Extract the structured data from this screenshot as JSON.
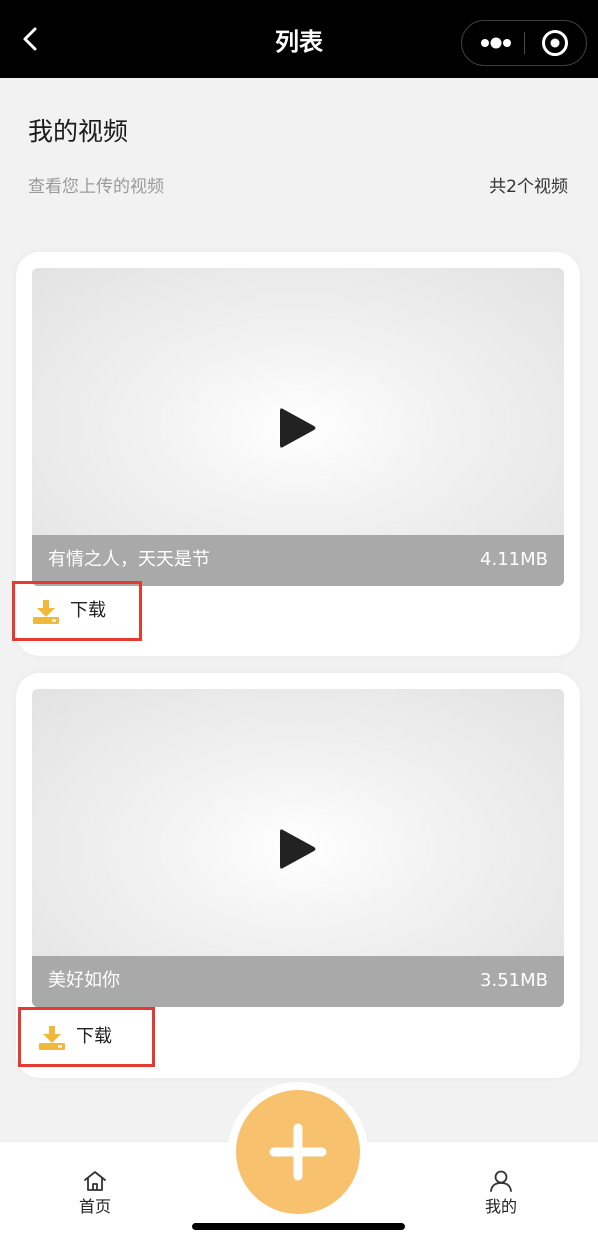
{
  "nav": {
    "title": "列表",
    "back_icon": "chevron-left-icon",
    "more_icon": "more-dots-icon",
    "close_icon": "target-circle-icon"
  },
  "header": {
    "title": "我的视频",
    "subtitle": "查看您上传的视频",
    "count": "共2个视频"
  },
  "videos": [
    {
      "title": "有情之人，天天是节",
      "size": "4.11MB",
      "download_label": "下载"
    },
    {
      "title": "美好如你",
      "size": "3.51MB",
      "download_label": "下载"
    }
  ],
  "tabbar": {
    "home_label": "首页",
    "mine_label": "我的",
    "add_icon": "plus-icon"
  },
  "colors": {
    "accent": "#f7c16e",
    "download_icon": "#f0b93a",
    "highlight_box": "#e53a2f",
    "navbar": "#000000"
  }
}
